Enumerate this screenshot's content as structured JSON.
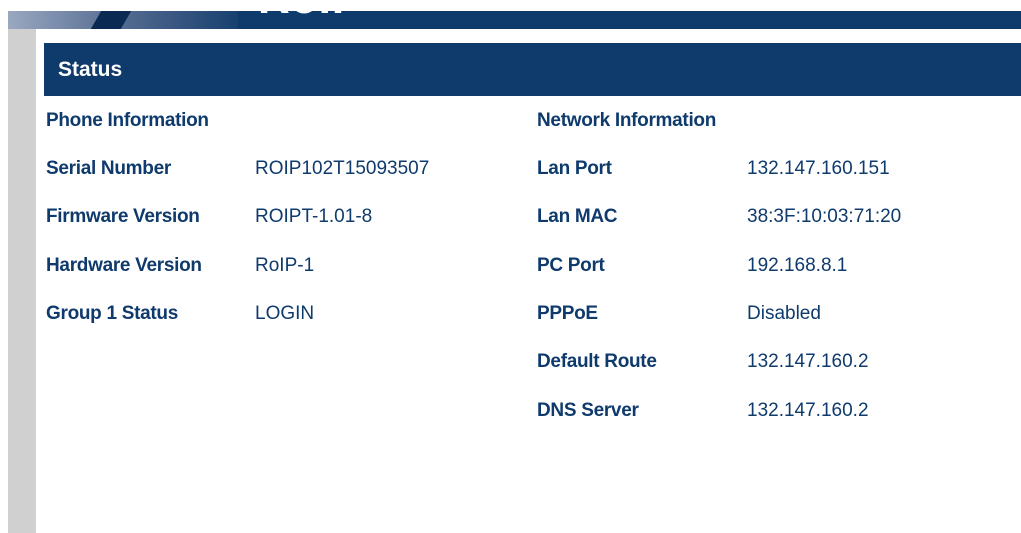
{
  "banner": {
    "logo_text": "RoIP"
  },
  "status": {
    "title": "Status"
  },
  "phone_info": {
    "title": "Phone Information",
    "rows": [
      {
        "label": "Serial Number",
        "value": "ROIP102T15093507"
      },
      {
        "label": "Firmware Version",
        "value": "ROIPT-1.01-8"
      },
      {
        "label": "Hardware Version",
        "value": "RoIP-1"
      },
      {
        "label": "Group 1 Status",
        "value": "LOGIN"
      }
    ]
  },
  "network_info": {
    "title": "Network Information",
    "rows": [
      {
        "label": "Lan Port",
        "value": "132.147.160.151"
      },
      {
        "label": "Lan MAC",
        "value": "38:3F:10:03:71:20"
      },
      {
        "label": "PC Port",
        "value": "192.168.8.1"
      },
      {
        "label": "PPPoE",
        "value": "Disabled"
      },
      {
        "label": "Default Route",
        "value": "132.147.160.2"
      },
      {
        "label": "DNS Server",
        "value": "132.147.160.2"
      }
    ]
  },
  "colors": {
    "header_navy": "#0f3a6c",
    "text_navy": "#0f3a6c",
    "rail_grey": "#d0d0d0"
  }
}
